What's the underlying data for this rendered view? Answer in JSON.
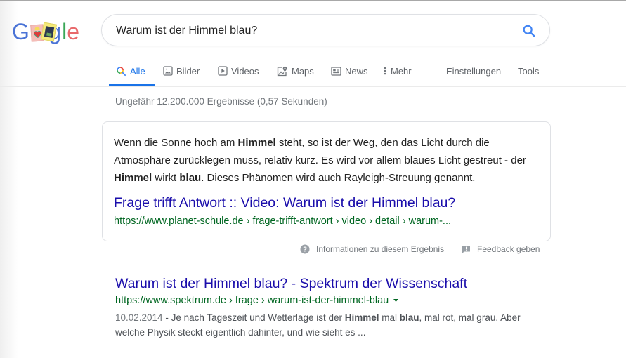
{
  "logo": {
    "letters": [
      "G",
      "g",
      "l",
      "e"
    ],
    "alt": "Google Doodle"
  },
  "search": {
    "query": "Warum ist der Himmel blau?",
    "icon": "search-icon"
  },
  "tabs": [
    {
      "label": "Alle",
      "icon": "search-icon",
      "active": true
    },
    {
      "label": "Bilder",
      "icon": "image-icon"
    },
    {
      "label": "Videos",
      "icon": "play-icon"
    },
    {
      "label": "Maps",
      "icon": "map-pin-icon"
    },
    {
      "label": "News",
      "icon": "newspaper-icon"
    },
    {
      "label": "Mehr",
      "icon": "more-vert-icon"
    }
  ],
  "tools": {
    "settings": "Einstellungen",
    "tools": "Tools"
  },
  "stats": "Ungefähr 12.200.000 Ergebnisse (0,57 Sekunden)",
  "featured_snippet": {
    "text_parts": [
      {
        "t": "Wenn die Sonne hoch am ",
        "b": false
      },
      {
        "t": "Himmel",
        "b": true
      },
      {
        "t": " steht, so ist der Weg, den das Licht durch die Atmosphäre zurücklegen muss, relativ kurz. Es wird vor allem blaues Licht gestreut - der ",
        "b": false
      },
      {
        "t": "Himmel",
        "b": true
      },
      {
        "t": " wirkt ",
        "b": false
      },
      {
        "t": "blau",
        "b": true
      },
      {
        "t": ". Dieses Phänomen wird auch Rayleigh-Streuung genannt.",
        "b": false
      }
    ],
    "title": "Frage trifft Antwort :: Video: Warum ist der Himmel blau?",
    "url": "https://www.planet-schule.de › frage-trifft-antwort › video › detail › warum-..."
  },
  "snippet_footer": {
    "info": "Informationen zu diesem Ergebnis",
    "feedback": "Feedback geben"
  },
  "results": [
    {
      "title": "Warum ist der Himmel blau? - Spektrum der Wissenschaft",
      "url": "https://www.spektrum.de › frage › warum-ist-der-himmel-blau",
      "date": "10.02.2014",
      "desc_parts": [
        {
          "t": " - Je nach Tageszeit und Wetterlage ist der ",
          "b": false
        },
        {
          "t": "Himmel",
          "b": true
        },
        {
          "t": " mal ",
          "b": false
        },
        {
          "t": "blau",
          "b": true
        },
        {
          "t": ", mal rot, mal grau. Aber welche Physik steckt eigentlich dahinter, und wie sieht es ...",
          "b": false
        }
      ]
    }
  ],
  "colors": {
    "link": "#1a0dab",
    "url": "#006621",
    "accent": "#1a73e8"
  }
}
